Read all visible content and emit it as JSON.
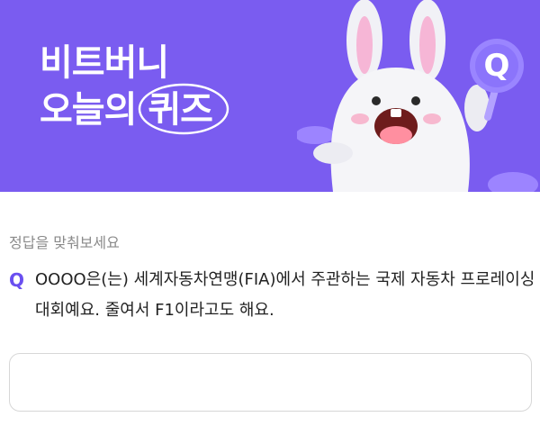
{
  "banner": {
    "title_line1": "비트버니",
    "title_line2_prefix": "오늘의 ",
    "title_line2_highlight": "퀴즈",
    "bg_color": "#7a5cf0",
    "badge_letter": "Q"
  },
  "instruction": "정답을 맞춰보세요",
  "question": {
    "mark": "Q",
    "text": "OOOO은(는) 세계자동차연맹(FIA)에서 주관하는 국제 자동차 프로레이싱 대회예요. 줄여서 F1이라고도 해요."
  },
  "answer": {
    "value": "",
    "placeholder": ""
  },
  "colors": {
    "accent": "#6a4ff0"
  }
}
